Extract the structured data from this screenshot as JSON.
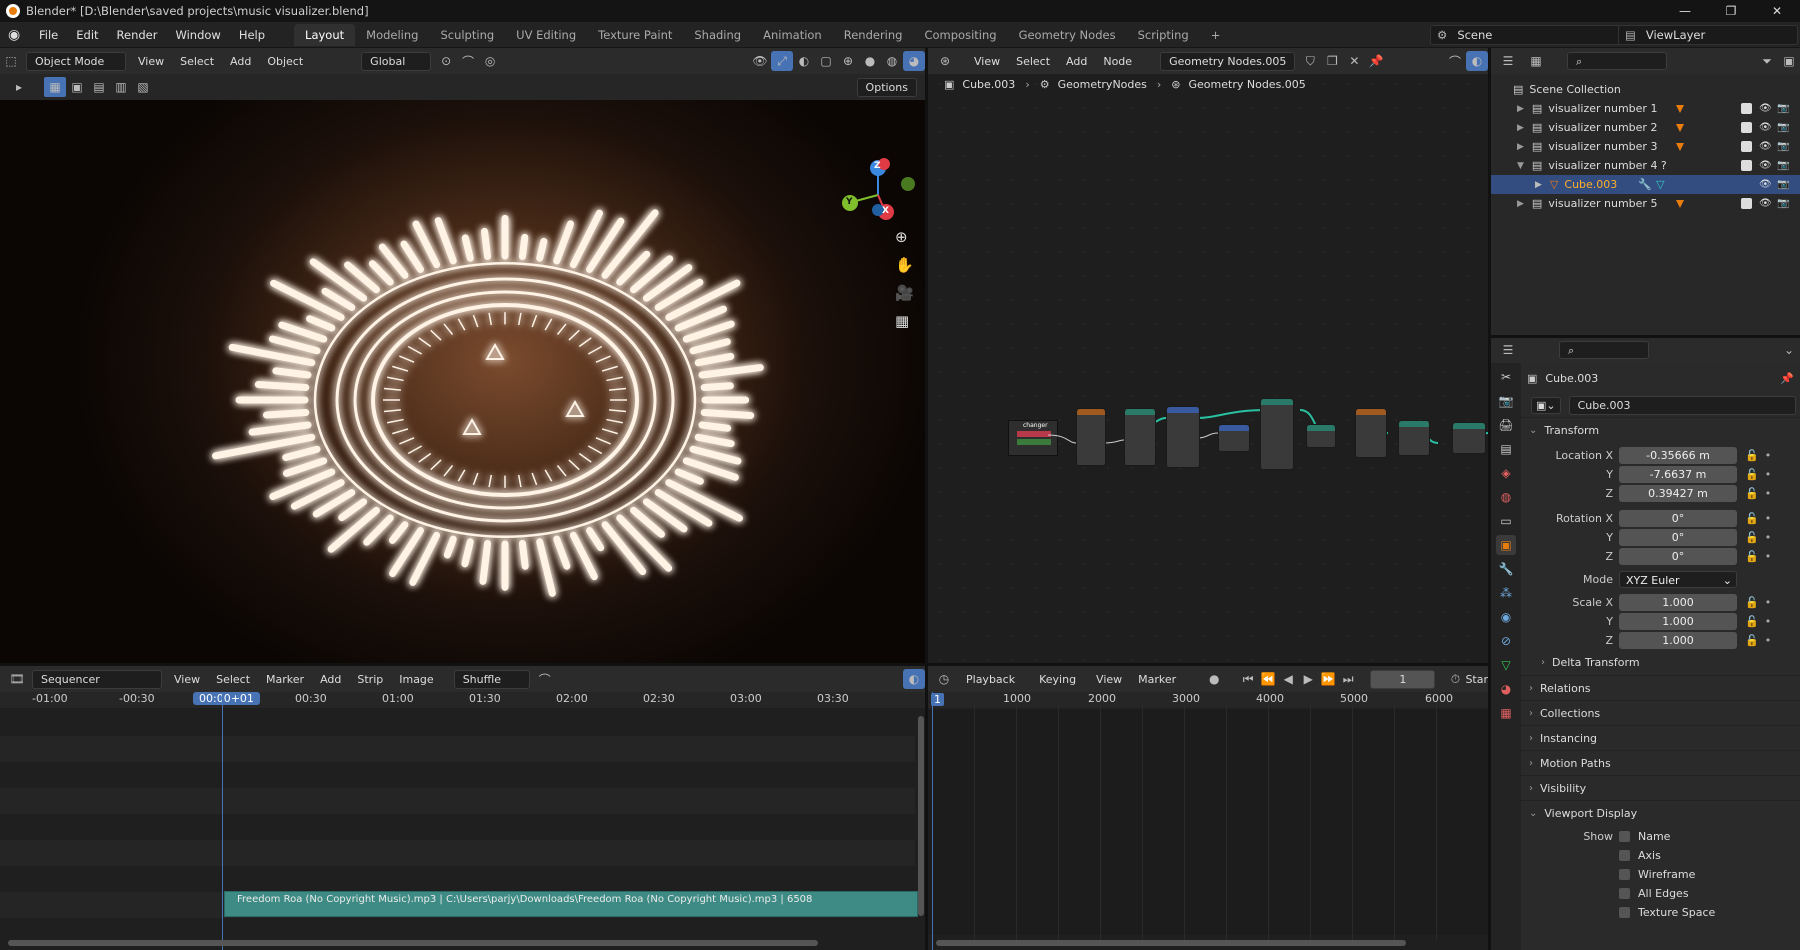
{
  "window": {
    "title": "Blender* [D:\\Blender\\saved projects\\music visualizer.blend]",
    "minimize": "—",
    "maximize": "❐",
    "close": "✕"
  },
  "menu": [
    "File",
    "Edit",
    "Render",
    "Window",
    "Help"
  ],
  "workspaces": [
    "Layout",
    "Modeling",
    "Sculpting",
    "UV Editing",
    "Texture Paint",
    "Shading",
    "Animation",
    "Rendering",
    "Compositing",
    "Geometry Nodes",
    "Scripting"
  ],
  "workspace_add": "+",
  "scene": {
    "name": "Scene",
    "view_layer": "ViewLayer"
  },
  "viewport": {
    "mode": "Object Mode",
    "menus": [
      "View",
      "Select",
      "Add",
      "Object"
    ],
    "orientation": "Global",
    "options": "Options",
    "gizmo": {
      "x": "X",
      "y": "Y",
      "z": "Z"
    }
  },
  "node_editor": {
    "menus": [
      "View",
      "Select",
      "Add",
      "Node"
    ],
    "tree_name": "Geometry Nodes.005",
    "breadcrumb": [
      "Cube.003",
      "GeometryNodes",
      "Geometry Nodes.005"
    ],
    "frame_label": "changer"
  },
  "outliner": {
    "root": "Scene Collection",
    "items": [
      {
        "label": "visualizer number 1",
        "selected": false
      },
      {
        "label": "visualizer number 2",
        "selected": false
      },
      {
        "label": "visualizer number 3",
        "selected": false
      },
      {
        "label": "visualizer number 4 ?",
        "selected": false
      },
      {
        "label": "Cube.003",
        "selected": true
      },
      {
        "label": "visualizer number  5",
        "selected": false
      }
    ]
  },
  "properties": {
    "object_name": "Cube.003",
    "data_name": "Cube.003",
    "transform_title": "Transform",
    "location_x_label": "Location X",
    "location_x": "-0.35666 m",
    "location_y_label": "Y",
    "location_y": "-7.6637 m",
    "location_z_label": "Z",
    "location_z": "0.39427 m",
    "rotation_x_label": "Rotation X",
    "rotation_x": "0°",
    "rotation_y_label": "Y",
    "rotation_y": "0°",
    "rotation_z_label": "Z",
    "rotation_z": "0°",
    "mode_label": "Mode",
    "mode": "XYZ Euler",
    "scale_x_label": "Scale X",
    "scale_x": "1.000",
    "scale_y_label": "Y",
    "scale_y": "1.000",
    "scale_z_label": "Z",
    "scale_z": "1.000",
    "delta_transform": "Delta Transform",
    "panels": [
      "Relations",
      "Collections",
      "Instancing",
      "Motion Paths",
      "Visibility"
    ],
    "viewport_display": "Viewport Display",
    "show_label": "Show",
    "show_options": [
      "Name",
      "Axis",
      "Wireframe",
      "All Edges",
      "Texture Space"
    ]
  },
  "sequencer": {
    "editor": "Sequencer",
    "menus": [
      "View",
      "Select",
      "Marker",
      "Add",
      "Strip",
      "Image"
    ],
    "mode": "Shuffle",
    "ticks": [
      "-01:00",
      "-00:30",
      "00:30",
      "01:00",
      "01:30",
      "02:00",
      "02:30",
      "03:00",
      "03:30"
    ],
    "current_time": "00:00+01",
    "strip_label": "Freedom  Roa (No Copyright Music).mp3 | C:\\Users\\parjy\\Downloads\\Freedom  Roa (No Copyright Music).mp3 | 6508"
  },
  "timeline": {
    "menus": [
      "Playback",
      "Keying",
      "View",
      "Marker"
    ],
    "frame": "1",
    "ticks": [
      "1",
      "1000",
      "2000",
      "3000",
      "4000",
      "5000",
      "6000"
    ],
    "start_label": "Star"
  }
}
